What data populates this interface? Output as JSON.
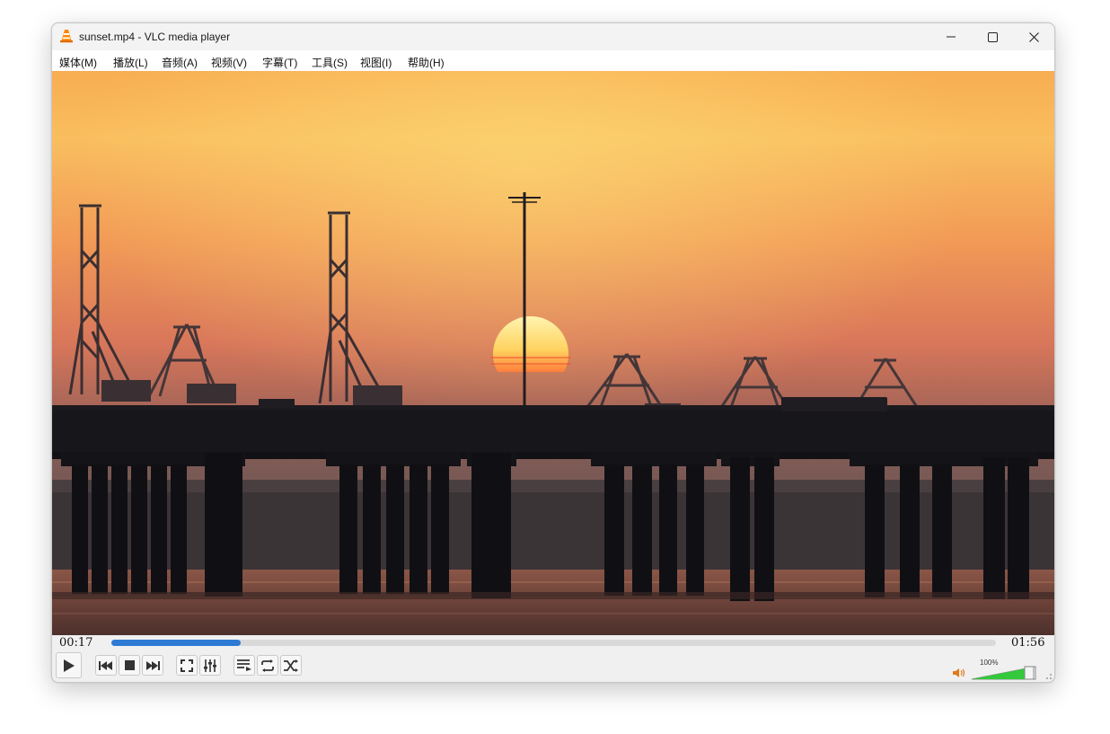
{
  "window": {
    "title": "sunset.mp4 - VLC media player"
  },
  "menu": {
    "items": [
      {
        "label": "媒体(M)"
      },
      {
        "label": "播放(L)"
      },
      {
        "label": "音频(A)"
      },
      {
        "label": "视频(V)"
      },
      {
        "label": "字幕(T)"
      },
      {
        "label": "工具(S)"
      },
      {
        "label": "视图(I)"
      },
      {
        "label": "帮助(H)"
      }
    ]
  },
  "playback": {
    "elapsed": "00:17",
    "total": "01:56",
    "progress_fraction": 0.146
  },
  "volume": {
    "label": "100%",
    "level_fraction": 1.0
  },
  "icons": {
    "app": "vlc-cone-icon",
    "minimize": "minimize-icon",
    "maximize": "maximize-icon",
    "close": "close-icon",
    "play": "play-icon",
    "previous": "previous-icon",
    "stop": "stop-icon",
    "next": "next-icon",
    "fullscreen": "fullscreen-icon",
    "extended_settings": "equalizer-icon",
    "playlist": "playlist-icon",
    "loop": "loop-icon",
    "shuffle": "shuffle-icon",
    "speaker": "speaker-icon"
  },
  "colors": {
    "accent": "#2e7bd6",
    "volume_fill": "#33c93a",
    "vlc_orange": "#ff8800"
  }
}
